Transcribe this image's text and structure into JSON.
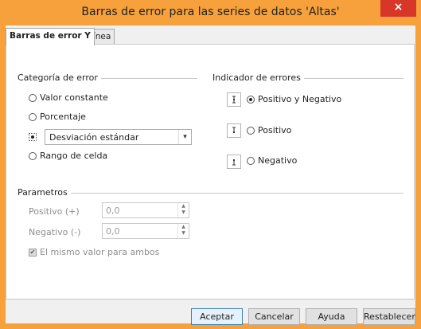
{
  "window": {
    "title": "Barras de error para las series de datos 'Altas'",
    "close_glyph": "×"
  },
  "tabs": [
    {
      "label": "Barras de error Y",
      "active": true
    },
    {
      "label": "Línea",
      "active": false
    }
  ],
  "category": {
    "group_label": "Categoría de error",
    "options": [
      {
        "label": "Valor constante",
        "checked": false
      },
      {
        "label": "Porcentaje",
        "checked": false
      },
      {
        "label": "",
        "checked": true
      },
      {
        "label": "Rango de celda",
        "checked": false
      }
    ],
    "select_value": "Desviación estándar"
  },
  "indicator": {
    "group_label": "Indicador de errores",
    "options": [
      {
        "label": "Positivo y Negativo",
        "checked": true
      },
      {
        "label": "Positivo",
        "checked": false
      },
      {
        "label": "Negativo",
        "checked": false
      }
    ]
  },
  "parameters": {
    "group_label": "Parametros",
    "positive_label": "Positivo (+)",
    "positive_value": "0,0",
    "negative_label": "Negativo (-)",
    "negative_value": "0,0",
    "same_value_label": "El mismo valor para ambos"
  },
  "footer": {
    "ok": "Aceptar",
    "cancel": "Cancelar",
    "help": "Ayuda",
    "reset": "Restablecer"
  },
  "colors": {
    "title_bar": "#f6a13b",
    "close_button": "#d9362a"
  }
}
